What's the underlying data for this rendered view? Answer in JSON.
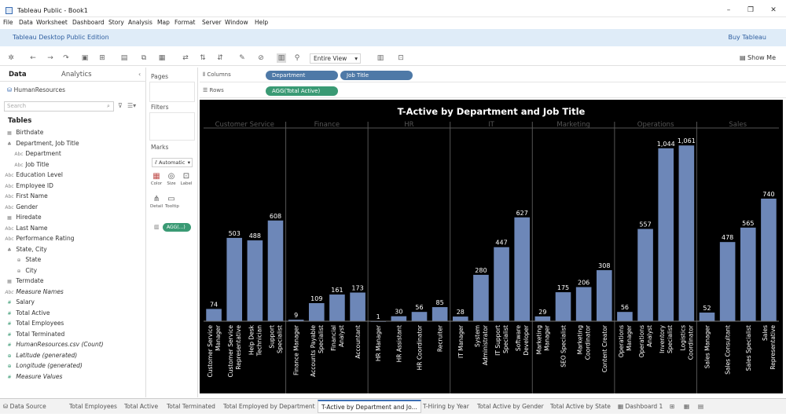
{
  "window": {
    "title": "Tableau Public - Book1"
  },
  "menu": [
    "File",
    "Data",
    "Worksheet",
    "Dashboard",
    "Story",
    "Analysis",
    "Map",
    "Format",
    "Server",
    "Window",
    "Help"
  ],
  "edition": {
    "label": "Tableau Desktop Public Edition",
    "buy": "Buy Tableau"
  },
  "toolbar": {
    "view_mode": "Entire View",
    "show_me": "Show Me"
  },
  "data_pane": {
    "tab_data": "Data",
    "tab_analytics": "Analytics",
    "datasource": "HumanResources",
    "search_placeholder": "Search",
    "tables_heading": "Tables",
    "fields": [
      {
        "label": "Birthdate",
        "kind": "dim",
        "icon": "calendar-icon"
      },
      {
        "label": "Department, Job Title",
        "kind": "dim",
        "icon": "hierarchy-icon"
      },
      {
        "label": "Department",
        "kind": "dim",
        "icon": "abc-icon"
      },
      {
        "label": "Job Title",
        "kind": "dim",
        "icon": "abc-icon"
      },
      {
        "label": "Education Level",
        "kind": "dim",
        "icon": "abc-icon"
      },
      {
        "label": "Employee ID",
        "kind": "dim",
        "icon": "abc-icon"
      },
      {
        "label": "First Name",
        "kind": "dim",
        "icon": "abc-icon"
      },
      {
        "label": "Gender",
        "kind": "dim",
        "icon": "abc-icon"
      },
      {
        "label": "Hiredate",
        "kind": "dim",
        "icon": "calendar-icon"
      },
      {
        "label": "Last Name",
        "kind": "dim",
        "icon": "abc-icon"
      },
      {
        "label": "Performance Rating",
        "kind": "dim",
        "icon": "abc-icon"
      },
      {
        "label": "State, City",
        "kind": "dim",
        "icon": "hierarchy-icon"
      },
      {
        "label": "State",
        "kind": "dim",
        "icon": "globe-icon"
      },
      {
        "label": "City",
        "kind": "dim",
        "icon": "globe-icon"
      },
      {
        "label": "Termdate",
        "kind": "dim",
        "icon": "calendar-icon"
      },
      {
        "label": "Measure Names",
        "kind": "dim",
        "icon": "abc-icon"
      },
      {
        "label": "Salary",
        "kind": "measure",
        "icon": "number-icon"
      },
      {
        "label": "Total Active",
        "kind": "measure",
        "icon": "number-icon"
      },
      {
        "label": "Total Employees",
        "kind": "measure",
        "icon": "number-icon"
      },
      {
        "label": "Total Terminated",
        "kind": "measure",
        "icon": "number-icon"
      },
      {
        "label": "HumanResources.csv (Count)",
        "kind": "measure",
        "icon": "number-icon"
      },
      {
        "label": "Latitude (generated)",
        "kind": "measure",
        "icon": "globe-icon"
      },
      {
        "label": "Longitude (generated)",
        "kind": "measure",
        "icon": "globe-icon"
      },
      {
        "label": "Measure Values",
        "kind": "measure",
        "icon": "number-icon"
      }
    ]
  },
  "cards": {
    "pages": "Pages",
    "filters": "Filters",
    "marks": "Marks",
    "marks_type": "Automatic",
    "mark_buttons": [
      "Color",
      "Size",
      "Label",
      "Detail",
      "Tooltip"
    ],
    "agg_pill": "AGG(...)"
  },
  "shelves": {
    "columns_label": "Columns",
    "rows_label": "Rows",
    "columns_pills": [
      "Department",
      "Job Title"
    ],
    "rows_pills": [
      "AGG(Total Active)"
    ]
  },
  "sheet_tabs": [
    "Data Source",
    "Total Employees",
    "Total Active",
    "Total Terminated",
    "Total Employed by Department",
    "T-Active by Department and Jo...",
    "T-Hiring by Year",
    "Total Active by Gender",
    "Total Active by State",
    "Dashboard 1"
  ],
  "active_sheet": 5,
  "colors": {
    "bar": "#6d87b8",
    "background": "#000000",
    "pill_dim": "#4e79a7",
    "pill_measure": "#3a9a74"
  },
  "chart_data": {
    "type": "bar",
    "title": "T-Active by Department and Job Title",
    "departments": [
      {
        "name": "Customer Service",
        "jobs": [
          "Customer Service Manager",
          "Customer Service Representative",
          "Help Desk Technician",
          "Support Specialist"
        ],
        "values": [
          74,
          503,
          488,
          608
        ]
      },
      {
        "name": "Finance",
        "jobs": [
          "Finance Manager",
          "Accounts Payable Specialist",
          "Financial Analyst",
          "Accountant"
        ],
        "values": [
          9,
          109,
          161,
          173
        ]
      },
      {
        "name": "HR",
        "jobs": [
          "HR Manager",
          "HR Assistant",
          "HR Coordinator",
          "Recruiter"
        ],
        "values": [
          1,
          30,
          56,
          85
        ]
      },
      {
        "name": "IT",
        "jobs": [
          "IT Manager",
          "System Administrator",
          "IT Support Specialist",
          "Software Developer"
        ],
        "values": [
          28,
          280,
          447,
          627
        ]
      },
      {
        "name": "Marketing",
        "jobs": [
          "Marketing Manager",
          "SEO Specialist",
          "Marketing Coordinator",
          "Content Creator"
        ],
        "values": [
          29,
          175,
          206,
          308
        ]
      },
      {
        "name": "Operations",
        "jobs": [
          "Operations Manager",
          "Operations Analyst",
          "Inventory Specialist",
          "Logistics Coordinator"
        ],
        "values": [
          56,
          557,
          1044,
          1061
        ]
      },
      {
        "name": "Sales",
        "jobs": [
          "Sales Manager",
          "Sales Consultant",
          "Sales Specialist",
          "Sales Representative"
        ],
        "values": [
          52,
          478,
          565,
          740
        ]
      }
    ],
    "value_labels": [
      "74",
      "503",
      "488",
      "608",
      "9",
      "109",
      "161",
      "173",
      "1",
      "30",
      "56",
      "85",
      "28",
      "280",
      "447",
      "627",
      "29",
      "175",
      "206",
      "308",
      "56",
      "557",
      "1,044",
      "1,061",
      "52",
      "478",
      "565",
      "740"
    ],
    "ylim": [
      0,
      1100
    ]
  }
}
